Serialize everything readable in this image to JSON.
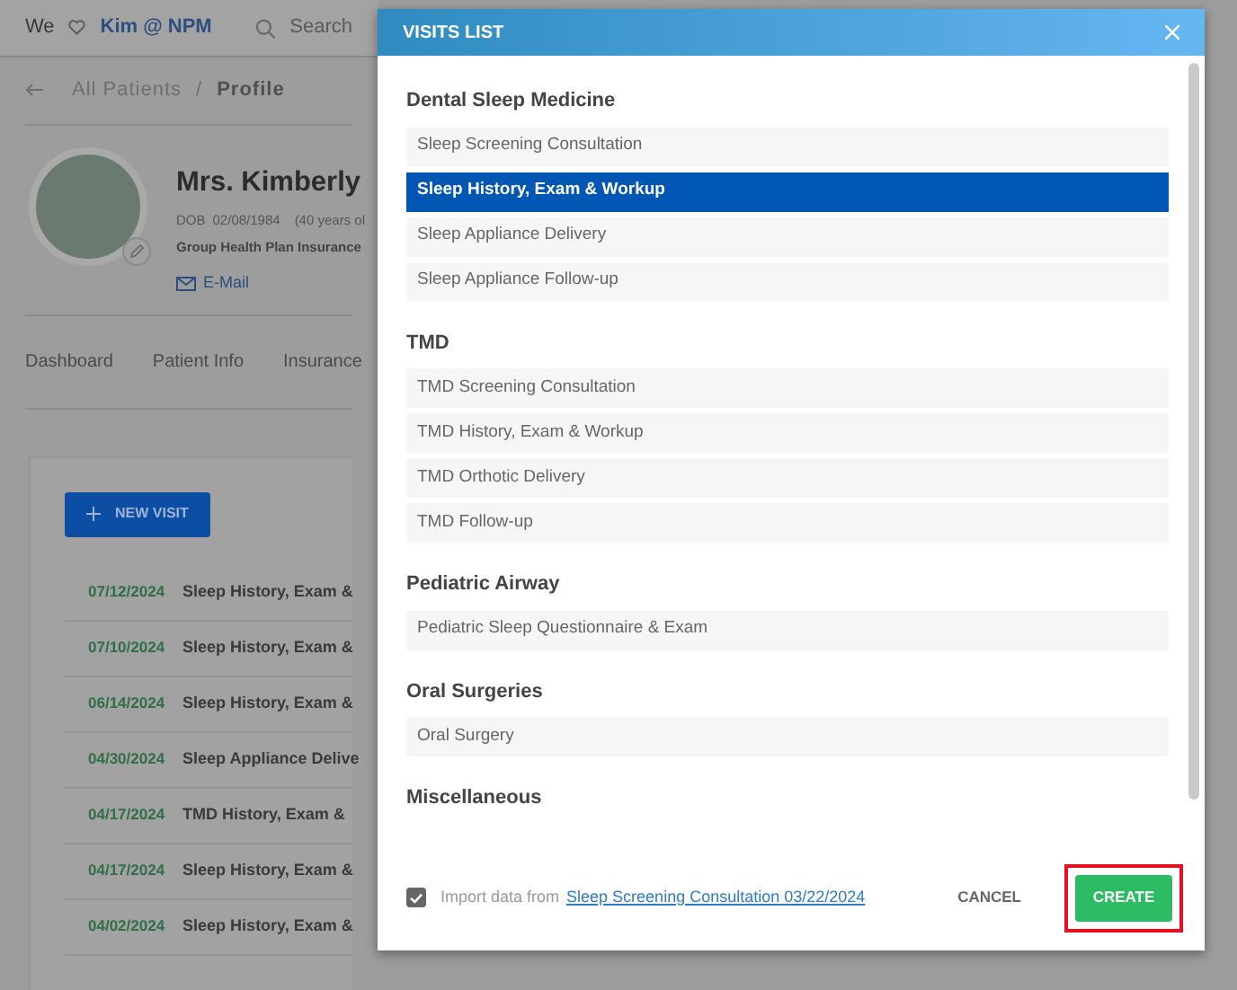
{
  "topbar": {
    "prefix": "We",
    "user": "Kim @ NPM",
    "search_placeholder": "Search"
  },
  "breadcrumb": {
    "items": [
      "All Patients",
      "Profile"
    ],
    "separator": "/"
  },
  "patient": {
    "name": "Mrs. Kimberly",
    "dob_label": "DOB",
    "dob": "02/08/1984",
    "age": "(40 years ol",
    "insurance": "Group Health Plan Insurance",
    "email": "E-Mail"
  },
  "tabs": [
    "Dashboard",
    "Patient Info",
    "Insurance"
  ],
  "new_visit": "NEW VISIT",
  "visits": [
    {
      "date": "07/12/2024",
      "title": "Sleep History, Exam &"
    },
    {
      "date": "07/10/2024",
      "title": "Sleep History, Exam &"
    },
    {
      "date": "06/14/2024",
      "title": "Sleep History, Exam &"
    },
    {
      "date": "04/30/2024",
      "title": "Sleep Appliance Delive"
    },
    {
      "date": "04/17/2024",
      "title": "TMD History, Exam &"
    },
    {
      "date": "04/17/2024",
      "title": "Sleep History, Exam &"
    },
    {
      "date": "04/02/2024",
      "title": "Sleep History, Exam &"
    }
  ],
  "modal": {
    "title": "VISITS LIST",
    "sections": [
      {
        "heading": "Dental Sleep Medicine",
        "items": [
          {
            "label": "Sleep Screening Consultation",
            "selected": false
          },
          {
            "label": "Sleep History, Exam & Workup",
            "selected": true
          },
          {
            "label": "Sleep Appliance Delivery",
            "selected": false
          },
          {
            "label": "Sleep Appliance Follow-up",
            "selected": false
          }
        ]
      },
      {
        "heading": "TMD",
        "items": [
          {
            "label": "TMD Screening Consultation",
            "selected": false
          },
          {
            "label": "TMD History, Exam & Workup",
            "selected": false
          },
          {
            "label": "TMD Orthotic Delivery",
            "selected": false
          },
          {
            "label": "TMD Follow-up",
            "selected": false
          }
        ]
      },
      {
        "heading": "Pediatric Airway",
        "items": [
          {
            "label": "Pediatric Sleep Questionnaire & Exam",
            "selected": false
          }
        ]
      },
      {
        "heading": "Oral Surgeries",
        "items": [
          {
            "label": "Oral Surgery",
            "selected": false
          }
        ]
      },
      {
        "heading": "Miscellaneous"
      }
    ],
    "import": {
      "checked": true,
      "prefix": "Import data from",
      "link": "Sleep Screening Consultation 03/22/2024"
    },
    "cancel": "CANCEL",
    "create": "CREATE"
  }
}
